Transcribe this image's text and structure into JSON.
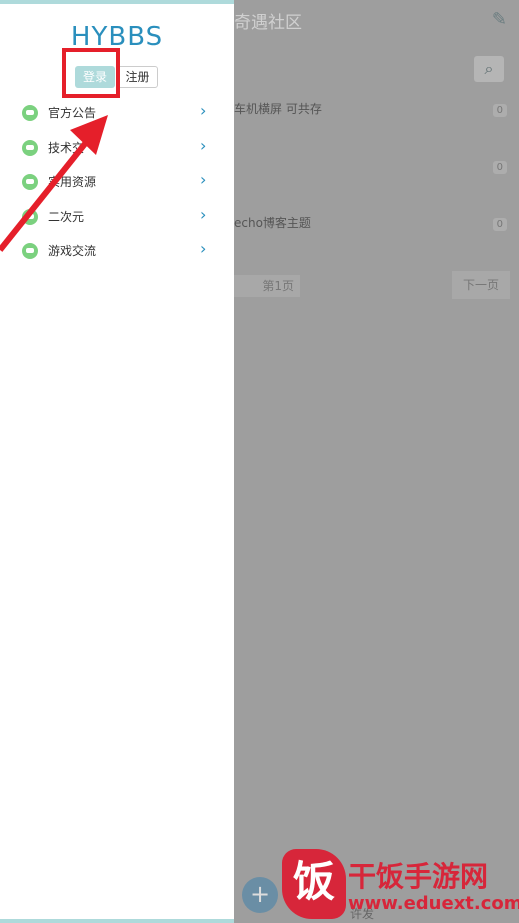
{
  "background": {
    "header_title": "奇遇社区",
    "posts": [
      {
        "title": "车机横屏 可共存",
        "count": "0"
      },
      {
        "title": "",
        "count": "0"
      },
      {
        "title": "echo博客主题",
        "count": "0"
      }
    ],
    "pagination": {
      "page_label": "第1页",
      "next_label": "下一页"
    },
    "bottom_tab": "许发"
  },
  "drawer": {
    "title": "HYBBS",
    "login_label": "登录",
    "register_label": "注册",
    "nav_items": [
      {
        "label": "官方公告"
      },
      {
        "label": "技术交"
      },
      {
        "label": "实用资源"
      },
      {
        "label": "二次元"
      },
      {
        "label": "游戏交流"
      }
    ]
  },
  "watermark": {
    "cn": "干饭手游网",
    "url": "www.eduext.com",
    "logo_char": "饭"
  },
  "colors": {
    "accent": "#2a8fbd",
    "login_bg": "#aedadb",
    "highlight": "#e51f2a",
    "icon_green": "#7bd17f"
  }
}
